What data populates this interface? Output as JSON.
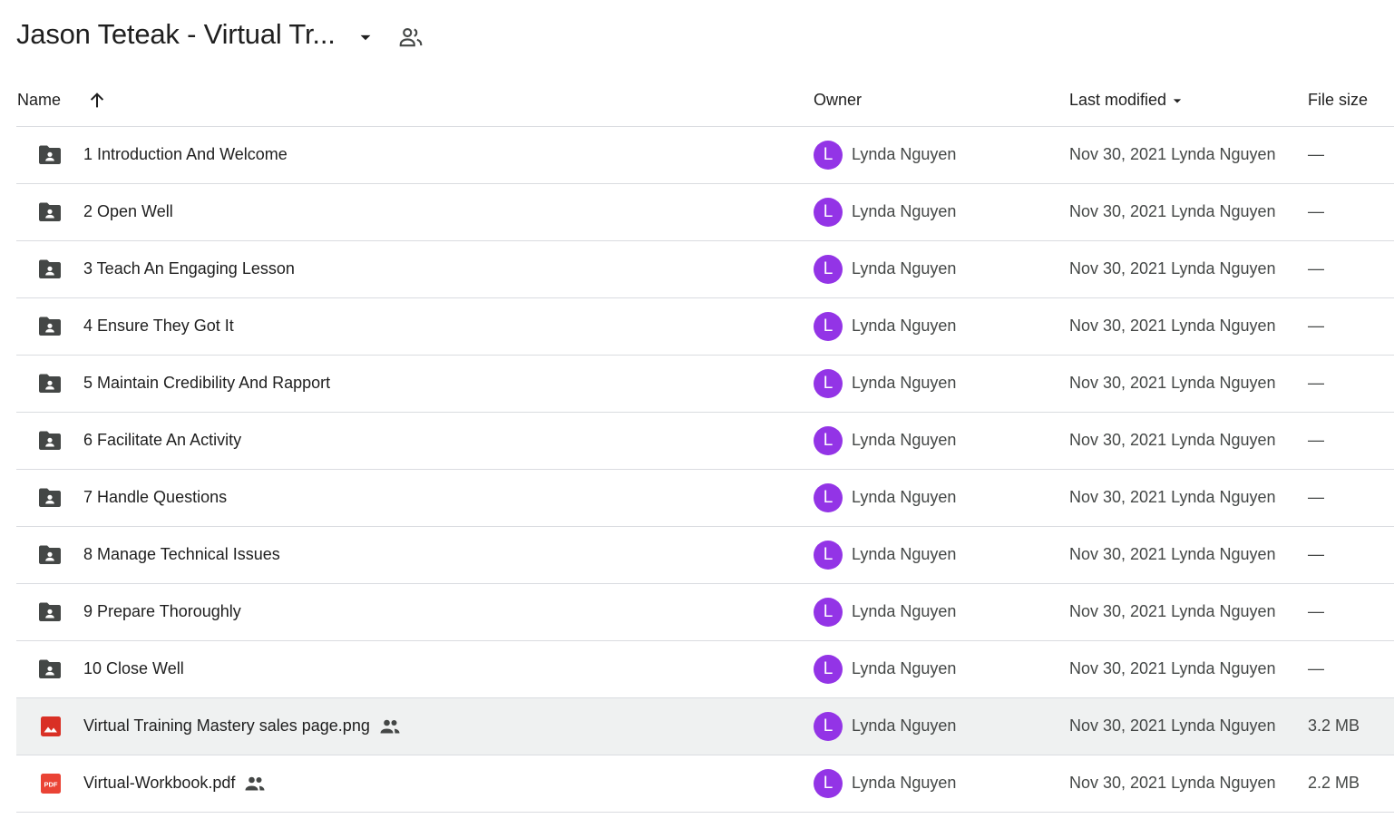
{
  "header": {
    "title": "Jason Teteak - Virtual Tr...",
    "caret_icon": "arrow-drop-down-icon",
    "people_icon": "shared-folder-people-icon"
  },
  "columns": {
    "name": "Name",
    "owner": "Owner",
    "last_modified": "Last modified",
    "file_size": "File size"
  },
  "colors": {
    "avatar": "#9334e6",
    "folder_icon": "#444746",
    "image_icon": "#d93025",
    "pdf_icon": "#ea4335",
    "selected_row": "#eff1f1"
  },
  "files": [
    {
      "name": "1 Introduction And Welcome",
      "type": "folder",
      "shared": false,
      "owner": "Lynda Nguyen",
      "avatar_letter": "L",
      "modified": "Nov 30, 2021 Lynda Nguyen",
      "size": "—"
    },
    {
      "name": "2 Open Well",
      "type": "folder",
      "shared": false,
      "owner": "Lynda Nguyen",
      "avatar_letter": "L",
      "modified": "Nov 30, 2021 Lynda Nguyen",
      "size": "—"
    },
    {
      "name": "3 Teach An Engaging Lesson",
      "type": "folder",
      "shared": false,
      "owner": "Lynda Nguyen",
      "avatar_letter": "L",
      "modified": "Nov 30, 2021 Lynda Nguyen",
      "size": "—"
    },
    {
      "name": "4 Ensure They Got It",
      "type": "folder",
      "shared": false,
      "owner": "Lynda Nguyen",
      "avatar_letter": "L",
      "modified": "Nov 30, 2021 Lynda Nguyen",
      "size": "—"
    },
    {
      "name": "5 Maintain Credibility And Rapport",
      "type": "folder",
      "shared": false,
      "owner": "Lynda Nguyen",
      "avatar_letter": "L",
      "modified": "Nov 30, 2021 Lynda Nguyen",
      "size": "—"
    },
    {
      "name": "6 Facilitate An Activity",
      "type": "folder",
      "shared": false,
      "owner": "Lynda Nguyen",
      "avatar_letter": "L",
      "modified": "Nov 30, 2021 Lynda Nguyen",
      "size": "—"
    },
    {
      "name": "7 Handle Questions",
      "type": "folder",
      "shared": false,
      "owner": "Lynda Nguyen",
      "avatar_letter": "L",
      "modified": "Nov 30, 2021 Lynda Nguyen",
      "size": "—"
    },
    {
      "name": "8 Manage Technical Issues",
      "type": "folder",
      "shared": false,
      "owner": "Lynda Nguyen",
      "avatar_letter": "L",
      "modified": "Nov 30, 2021 Lynda Nguyen",
      "size": "—"
    },
    {
      "name": "9 Prepare Thoroughly",
      "type": "folder",
      "shared": false,
      "owner": "Lynda Nguyen",
      "avatar_letter": "L",
      "modified": "Nov 30, 2021 Lynda Nguyen",
      "size": "—"
    },
    {
      "name": "10 Close Well",
      "type": "folder",
      "shared": false,
      "owner": "Lynda Nguyen",
      "avatar_letter": "L",
      "modified": "Nov 30, 2021 Lynda Nguyen",
      "size": "—"
    },
    {
      "name": "Virtual Training Mastery sales page.png",
      "type": "image",
      "shared": true,
      "selected": true,
      "owner": "Lynda Nguyen",
      "avatar_letter": "L",
      "modified": "Nov 30, 2021 Lynda Nguyen",
      "size": "3.2 MB"
    },
    {
      "name": "Virtual-Workbook.pdf",
      "type": "pdf",
      "shared": true,
      "owner": "Lynda Nguyen",
      "avatar_letter": "L",
      "modified": "Nov 30, 2021 Lynda Nguyen",
      "size": "2.2 MB",
      "pdf_badge": "PDF"
    }
  ]
}
